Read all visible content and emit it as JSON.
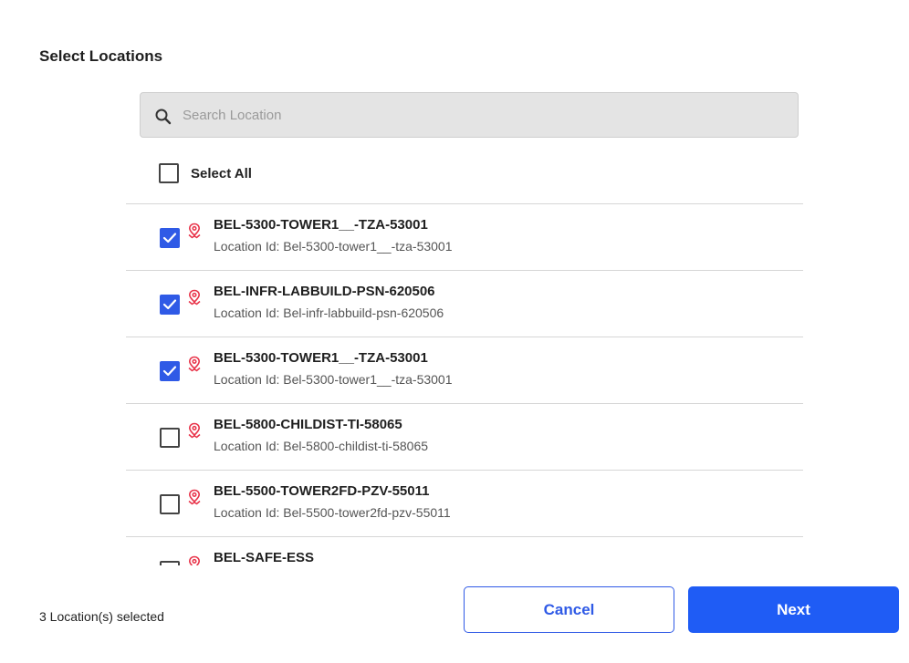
{
  "header": {
    "title": "Select Locations"
  },
  "search": {
    "placeholder": "Search Location",
    "value": ""
  },
  "select_all": {
    "label": "Select All",
    "checked": false
  },
  "locations": [
    {
      "name": "BEL-5300-TOWER1__-TZA-53001",
      "sub": "Location Id: Bel-5300-tower1__-tza-53001",
      "checked": true
    },
    {
      "name": "BEL-INFR-LABBUILD-PSN-620506",
      "sub": "Location Id: Bel-infr-labbuild-psn-620506",
      "checked": true
    },
    {
      "name": "BEL-5300-TOWER1__-TZA-53001",
      "sub": "Location Id: Bel-5300-tower1__-tza-53001",
      "checked": true
    },
    {
      "name": "BEL-5800-CHILDIST-TI-58065",
      "sub": "Location Id: Bel-5800-childist-ti-58065",
      "checked": false
    },
    {
      "name": "BEL-5500-TOWER2FD-PZV-55011",
      "sub": "Location Id: Bel-5500-tower2fd-pzv-55011",
      "checked": false
    },
    {
      "name": "BEL-SAFE-ESS",
      "sub": "",
      "checked": false
    }
  ],
  "footer": {
    "selected_count": "3 Location(s) selected",
    "cancel_label": "Cancel",
    "next_label": "Next"
  },
  "colors": {
    "accent": "#1f5cf5",
    "checkbox_checked": "#2f5ae6",
    "pin_icon": "#e8344a"
  },
  "icons": {
    "search": "search-icon",
    "location": "location-pin-icon",
    "check": "check-icon"
  }
}
